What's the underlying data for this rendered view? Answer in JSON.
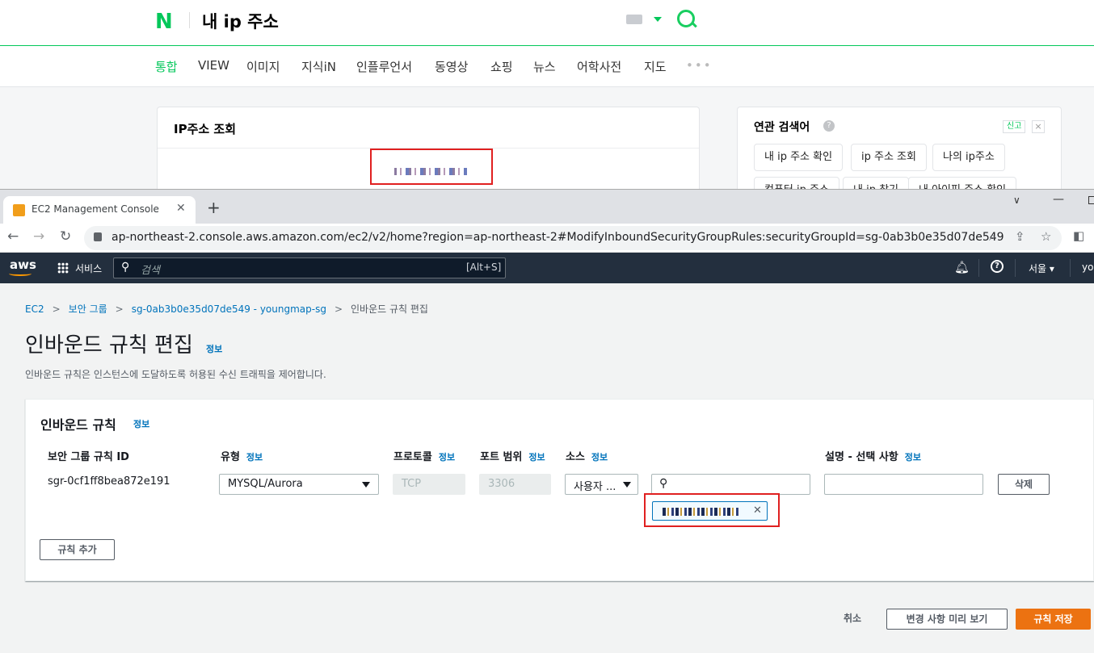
{
  "naver": {
    "logo": "N",
    "query": "내 ip 주소",
    "tabs": [
      "통합",
      "VIEW",
      "이미지",
      "지식iN",
      "인플루언서",
      "동영상",
      "쇼핑",
      "뉴스",
      "어학사전",
      "지도"
    ],
    "more": "•••",
    "ip_card_title": "IP주소 조회",
    "related_title": "연관 검색어",
    "report": "신고",
    "close": "×",
    "related": [
      "내 ip 주소 확인",
      "ip 주소 조회",
      "나의 ip주소",
      "컴퓨터 ip 주소",
      "내 ip 찾기",
      "내 아이피 주소 확인"
    ]
  },
  "browser": {
    "tab_title": "EC2 Management Console",
    "tab_close": "✕",
    "new_tab": "+",
    "url": "ap-northeast-2.console.aws.amazon.com/ec2/v2/home?region=ap-northeast-2#ModifyInboundSecurityGroupRules:securityGroupId=sg-0ab3b0e35d07de549"
  },
  "aws": {
    "logo": "aws",
    "services": "서비스",
    "search_placeholder": "검색",
    "search_shortcut": "[Alt+S]",
    "region": "서울 ▾",
    "account": "you"
  },
  "console": {
    "breadcrumb": [
      "EC2",
      "보안 그룹",
      "sg-0ab3b0e35d07de549 - youngmap-sg",
      "인바운드 규칙 편집"
    ],
    "title": "인바운드 규칙 편집",
    "info": "정보",
    "description": "인바운드 규칙은 인스턴스에 도달하도록 허용된 수신 트래픽을 제어합니다.",
    "panel_title": "인바운드 규칙",
    "columns": {
      "rule_id": "보안 그룹 규칙 ID",
      "type": "유형",
      "protocol": "프로토콜",
      "port_range": "포트 범위",
      "source": "소스",
      "description": "설명 - 선택 사항"
    },
    "rule": {
      "id": "sgr-0cf1ff8bea872e191",
      "type": "MYSQL/Aurora",
      "protocol": "TCP",
      "port": "3306",
      "source": "사용자 ...",
      "description": ""
    },
    "delete": "삭제",
    "add_rule": "규칙 추가",
    "cancel": "취소",
    "preview": "변경 사항 미리 보기",
    "save": "규칙 저장"
  }
}
